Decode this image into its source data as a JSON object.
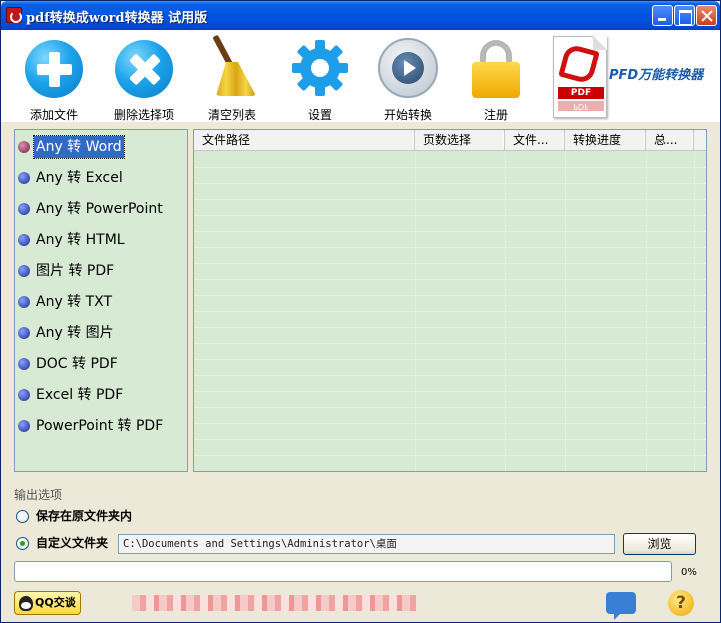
{
  "window": {
    "title": "pdf转换成word转换器 试用版"
  },
  "toolbar": {
    "add_files": "添加文件",
    "delete_selected": "删除选择项",
    "clear_list": "清空列表",
    "settings": "设置",
    "start_convert": "开始转换",
    "register": "注册",
    "pdf_badge": "PDF",
    "brand": "PFD万能转换器"
  },
  "conversions": {
    "items": [
      {
        "label": "Any 转 Word",
        "selected": true
      },
      {
        "label": "Any 转 Excel"
      },
      {
        "label": "Any 转 PowerPoint"
      },
      {
        "label": "Any 转 HTML"
      },
      {
        "label": "图片 转 PDF"
      },
      {
        "label": "Any 转 TXT"
      },
      {
        "label": "Any 转 图片"
      },
      {
        "label": "DOC 转 PDF"
      },
      {
        "label": "Excel 转 PDF"
      },
      {
        "label": "PowerPoint 转 PDF"
      }
    ]
  },
  "file_table": {
    "columns": [
      "文件路径",
      "页数选择",
      "文件...",
      "转换进度",
      "总..."
    ],
    "rows": []
  },
  "output": {
    "title": "输出选项",
    "option_source_folder": "保存在原文件夹内",
    "option_custom_folder": "自定义文件夹",
    "selected_option": "custom",
    "path": "C:\\Documents and Settings\\Administrator\\桌面",
    "browse": "浏览"
  },
  "progress": {
    "value": 0,
    "label": "0%"
  },
  "footer": {
    "qq_button": "QQ交谈",
    "help": "?"
  },
  "colors": {
    "title_bar": "#0054e3",
    "panel_bg": "#d6ead4",
    "window_bg": "#ece9d8",
    "selection": "#316ac5",
    "brand": "#1a5ca8"
  }
}
